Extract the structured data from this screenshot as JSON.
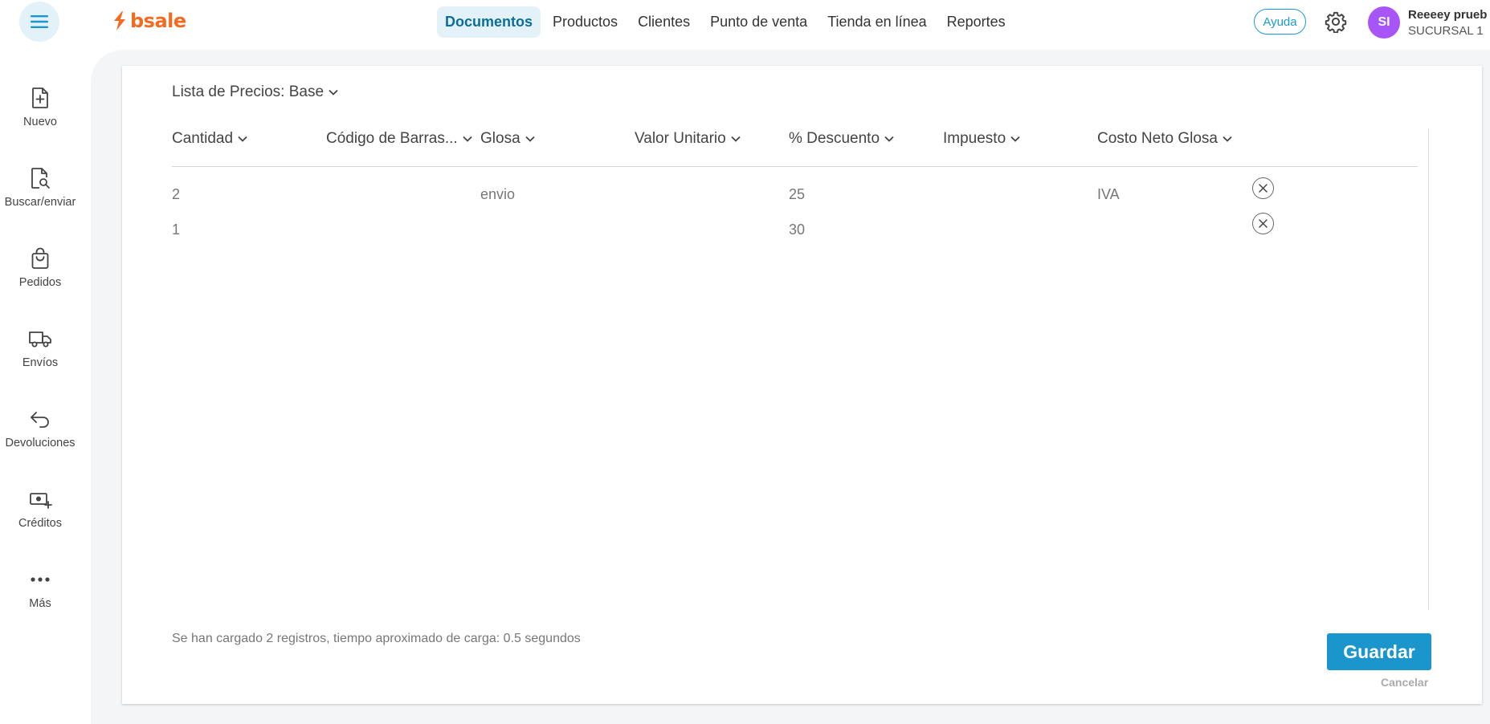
{
  "app": {
    "logo_text": "bsale",
    "brand_color": "#f26b21",
    "accent_color": "#1a96cc"
  },
  "topnav": {
    "menu_icon": "hamburger-menu-icon",
    "items": [
      {
        "label": "Documentos",
        "active": true
      },
      {
        "label": "Productos",
        "active": false
      },
      {
        "label": "Clientes",
        "active": false
      },
      {
        "label": "Punto de venta",
        "active": false
      },
      {
        "label": "Tienda en línea",
        "active": false
      },
      {
        "label": "Reportes",
        "active": false
      }
    ],
    "help_label": "Ayuda",
    "settings_icon": "gear-icon"
  },
  "user": {
    "initials": "SI",
    "name": "Reeeey prueb",
    "branch": "SUCURSAL 1",
    "avatar_color": "#a855f7"
  },
  "sidebar": {
    "items": [
      {
        "label": "Nuevo",
        "icon": "new-document-icon"
      },
      {
        "label": "Buscar/enviar",
        "icon": "search-document-icon"
      },
      {
        "label": "Pedidos",
        "icon": "shopping-bag-icon"
      },
      {
        "label": "Envíos",
        "icon": "truck-icon"
      },
      {
        "label": "Devoluciones",
        "icon": "return-arrow-icon"
      },
      {
        "label": "Créditos",
        "icon": "credit-cash-icon"
      },
      {
        "label": "Más",
        "icon": "more-dots-icon"
      }
    ]
  },
  "main": {
    "price_list_label": "Lista de Precios: Base",
    "columns": [
      "Cantidad",
      "Código de Barras...",
      "Glosa",
      "Valor Unitario",
      "% Descuento",
      "Impuesto",
      "Costo Neto Glosa"
    ],
    "rows": [
      [
        "2",
        "",
        "envio",
        "",
        "25",
        "",
        "IVA"
      ],
      [
        "1",
        "",
        "",
        "",
        "30",
        "",
        ""
      ]
    ],
    "status_text": "Se han cargado 2 registros, tiempo aproximado de carga: 0.5 segundos",
    "save_label": "Guardar",
    "cancel_label": "Cancelar"
  }
}
